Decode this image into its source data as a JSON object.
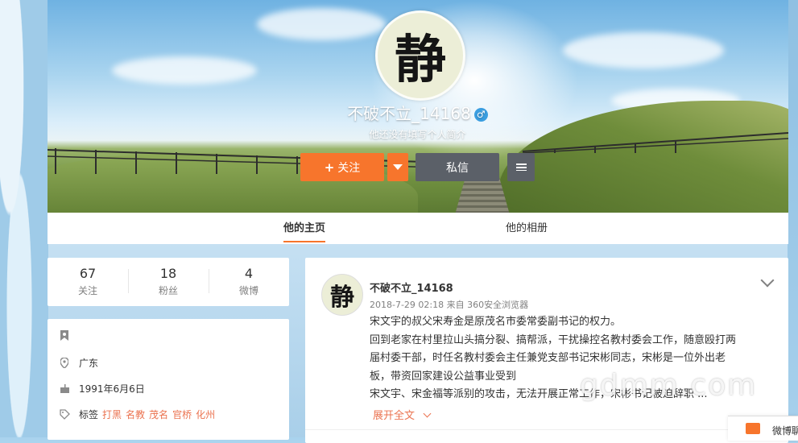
{
  "profile": {
    "username": "不破不立_14168",
    "gender_symbol": "♂",
    "bio": "他还没有填写个人简介",
    "avatar_char": "静"
  },
  "actions": {
    "follow_label": "关注",
    "follow_icon": "+",
    "message_label": "私信"
  },
  "nav": {
    "tabs": [
      {
        "label": "他的主页",
        "active": true
      },
      {
        "label": "他的相册",
        "active": false
      }
    ]
  },
  "stats": [
    {
      "value": "67",
      "label": "关注"
    },
    {
      "value": "18",
      "label": "粉丝"
    },
    {
      "value": "4",
      "label": "微博"
    }
  ],
  "info": {
    "location": "广东",
    "birthday": "1991年6月6日",
    "tags_label": "标签",
    "tags": [
      "打黑",
      "名教",
      "茂名",
      "官桥",
      "化州"
    ]
  },
  "feed": {
    "post": {
      "author": "不破不立_14168",
      "meta": "2018-7-29 02:18 来自 360安全浏览器",
      "lines": [
        "宋文宇的叔父宋寿金是原茂名市委常委副书记的权力。",
        "回到老家在村里拉山头搞分裂、搞帮派，干扰操控名教村委会工作，随意殴打两",
        "届村委干部，时任名教村委会主任兼党支部书记宋彬同志，宋彬是一位外出老",
        "板，带资回家建设公益事业受到",
        "宋文宇、宋金福等派别的攻击，无法开展正常工作，宋彬书记被迫辞职 ..."
      ],
      "expand_label": "展开全文"
    }
  },
  "watermark": "gdmm.com",
  "side_panel": {
    "label": "微博聊天"
  },
  "colors": {
    "accent": "#f7752c",
    "link": "#eb7350",
    "dark_button": "#5b6068"
  }
}
